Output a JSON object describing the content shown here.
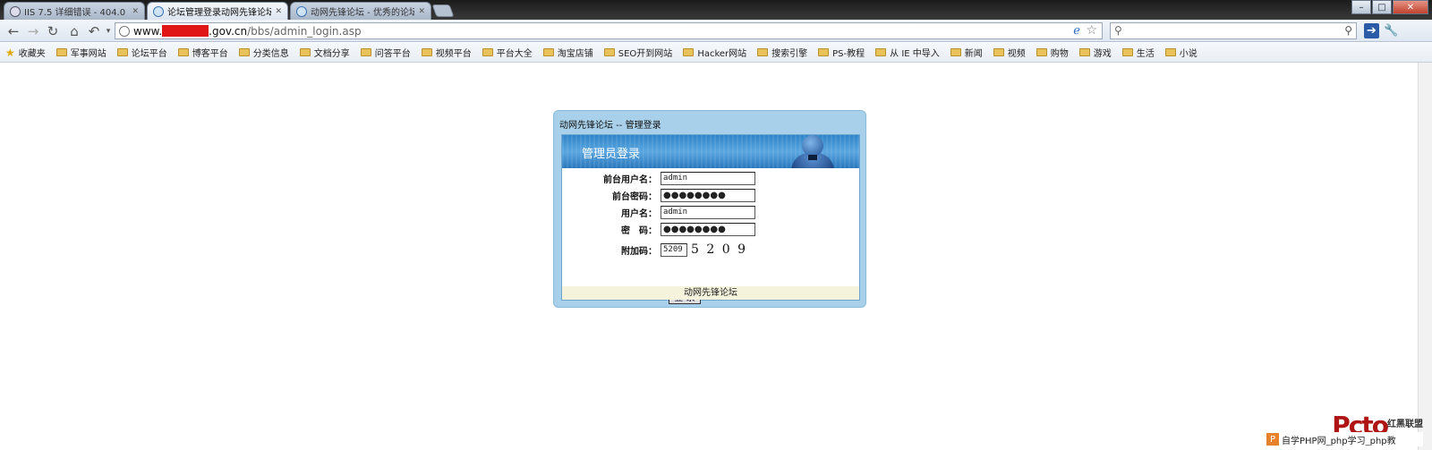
{
  "tabs": [
    {
      "label": "IIS 7.5 详细错误 - 404.0 -",
      "active": false
    },
    {
      "label": "论坛管理登录动网先锋论坛",
      "active": true
    },
    {
      "label": "动网先锋论坛 - 优秀的论坛",
      "active": false
    }
  ],
  "window_controls": {
    "minimize": "–",
    "maximize": "□",
    "close": "✕"
  },
  "address": {
    "prefix": "www.",
    "domain": ".gov.cn",
    "path": "/bbs/admin_login.asp"
  },
  "bookmarks": {
    "favorites": "收藏夹",
    "items": [
      "军事网站",
      "论坛平台",
      "博客平台",
      "分类信息",
      "文档分享",
      "问答平台",
      "视频平台",
      "平台大全",
      "淘宝店铺",
      "SEO开到网站",
      "Hacker网站",
      "搜索引擎",
      "PS-教程",
      "从 IE 中导入",
      "新闻",
      "视频",
      "购物",
      "游戏",
      "生活",
      "小说"
    ]
  },
  "login": {
    "panel_title": "动网先锋论坛 -- 管理登录",
    "banner_title": "管理员登录",
    "fields": [
      {
        "label": "前台用户名：",
        "value": "admin",
        "type": "text"
      },
      {
        "label": "前台密码：",
        "value": "●●●●●●●●",
        "type": "password"
      },
      {
        "label": "用户名：",
        "value": "admin",
        "type": "text"
      },
      {
        "label": "密　码：",
        "value": "●●●●●●●●",
        "type": "password"
      }
    ],
    "captcha_label": "附加码：",
    "captcha_input": "5209",
    "captcha_image": "5 2 0 9",
    "submit": "登 录",
    "footer": "动网先锋论坛"
  },
  "watermark": {
    "logo": "Pcto",
    "sub": "红黑联盟",
    "bar_icon": "P",
    "bar": "自学PHP网_php学习_php教"
  }
}
